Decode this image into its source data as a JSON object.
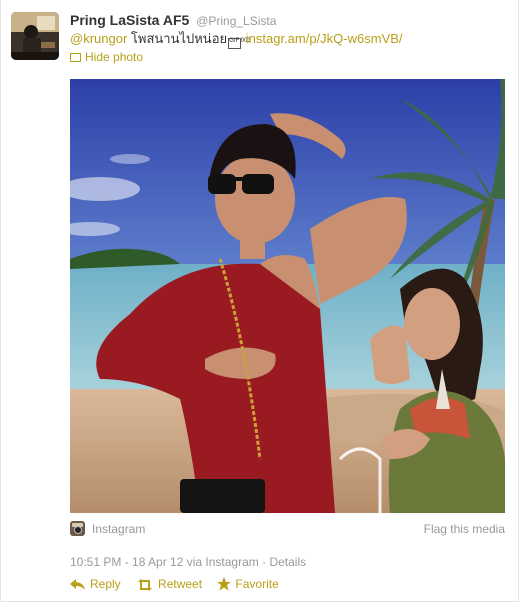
{
  "user": {
    "fullname": "Pring LaSista AF5",
    "handle": "@Pring_LSista"
  },
  "tweet": {
    "mention": "@krungor",
    "text": " โพสนานไปหน่อย",
    "glyph": "GIF 003",
    "url": "instagr.am/p/JkQ-w6smVB/"
  },
  "media": {
    "hide_label": "Hide photo",
    "source_label": "Instagram",
    "flag_label": "Flag this media"
  },
  "meta": {
    "timestamp": "10:51 PM - 18 Apr 12 via Instagram",
    "separator": " · ",
    "details_label": "Details"
  },
  "actions": {
    "reply_label": "Reply",
    "retweet_label": "Retweet",
    "favorite_label": "Favorite"
  },
  "colors": {
    "link": "#b8a01a",
    "muted": "#999999"
  }
}
